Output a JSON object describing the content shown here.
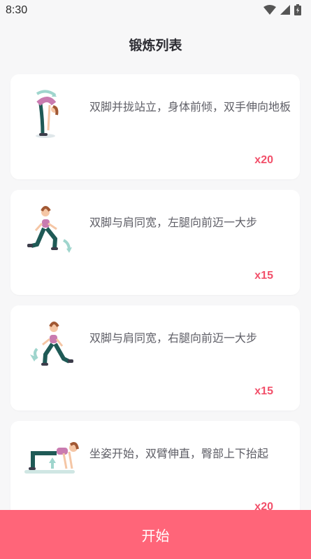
{
  "status_bar": {
    "time": "8:30",
    "icons": [
      "wifi-icon",
      "signal-icon",
      "battery-icon"
    ]
  },
  "page": {
    "title": "锻炼列表"
  },
  "exercises": [
    {
      "illustration": "forward-bend-icon",
      "description": "双脚并拢站立，身体前倾，双手伸向地板",
      "count": "x20"
    },
    {
      "illustration": "left-lunge-icon",
      "description": "双脚与肩同宽，左腿向前迈一大步",
      "count": "x15"
    },
    {
      "illustration": "right-lunge-icon",
      "description": "双脚与肩同宽，右腿向前迈一大步",
      "count": "x15"
    },
    {
      "illustration": "hip-lift-icon",
      "description": "坐姿开始，双臂伸直，臀部上下抬起",
      "count": "x20"
    }
  ],
  "footer": {
    "start_label": "开始"
  },
  "colors": {
    "accent": "#ff6579",
    "count": "#f2506a",
    "background": "#f7f7f8"
  }
}
